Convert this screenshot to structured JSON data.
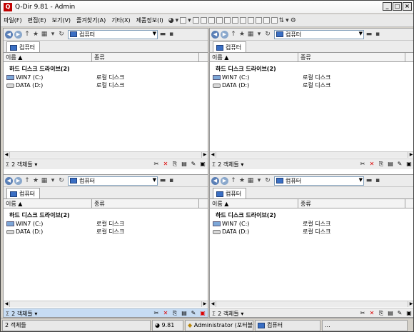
{
  "window": {
    "title": "Q-Dir 9.81 - Admin"
  },
  "menu": [
    "파일(F)",
    "편집(E)",
    "보기(V)",
    "즐겨찾기(A)",
    "기타(X)",
    "제품정보(I)"
  ],
  "panes": [
    {
      "address": "컴퓨터",
      "tab": "컴퓨터",
      "col_name": "이름",
      "col_type": "종류",
      "group": "하드 디스크 드라이브(2)",
      "drives": [
        {
          "name": "WIN7 (C:)",
          "type": "로컬 디스크"
        },
        {
          "name": "DATA (D:)",
          "type": "로컬 디스크"
        }
      ],
      "status": "2 객체들"
    },
    {
      "address": "컴퓨터",
      "tab": "컴퓨터",
      "col_name": "이름",
      "col_type": "종류",
      "group": "하드 디스크 드라이브(2)",
      "drives": [
        {
          "name": "WIN7 (C:)",
          "type": "로컬 디스크"
        },
        {
          "name": "DATA (D:)",
          "type": "로컬 디스크"
        }
      ],
      "status": "2 객체들"
    },
    {
      "address": "컴퓨터",
      "tab": "컴퓨터",
      "col_name": "이름",
      "col_type": "종류",
      "group": "하드 디스크 드라이브(2)",
      "drives": [
        {
          "name": "WIN7 (C:)",
          "type": "로컬 디스크"
        },
        {
          "name": "DATA (D:)",
          "type": "로컬 디스크"
        }
      ],
      "status": "2 객체들"
    },
    {
      "address": "컴퓨터",
      "tab": "컴퓨터",
      "col_name": "이름",
      "col_type": "종류",
      "group": "하드 디스크 드라이브(2)",
      "drives": [
        {
          "name": "WIN7 (C:)",
          "type": "로컬 디스크"
        },
        {
          "name": "DATA (D:)",
          "type": "로컬 디스크"
        }
      ],
      "status": "2 객체들"
    }
  ],
  "statusbar": {
    "count": "2 객체들",
    "version": "9.81",
    "user": "Administrator (포터블",
    "location": "컴퓨터",
    "extra": "..."
  }
}
